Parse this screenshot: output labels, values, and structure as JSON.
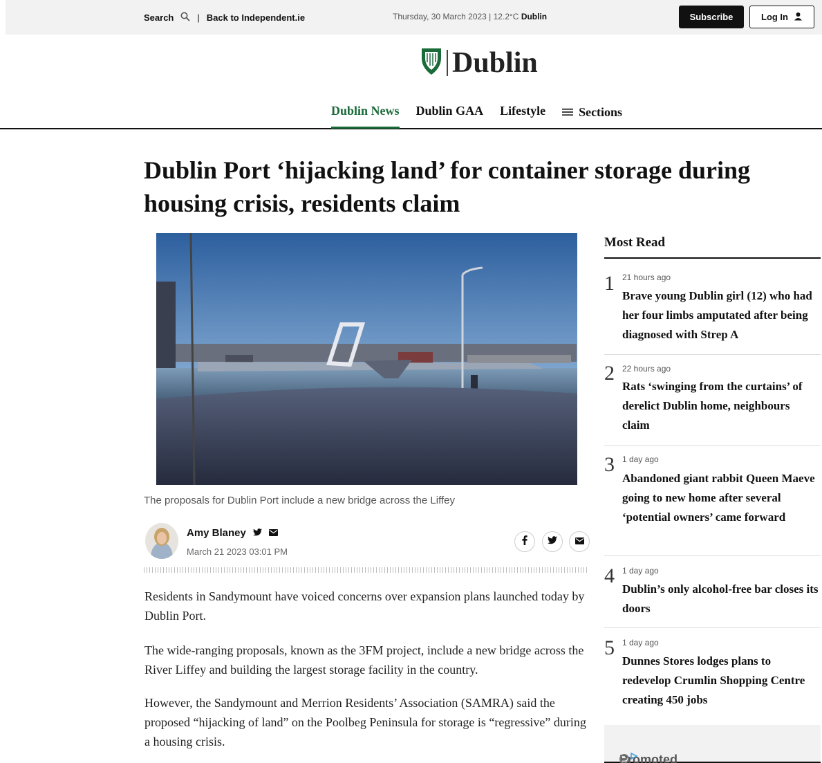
{
  "topbar": {
    "search_label": "Search",
    "back_label": "Back to Independent.ie",
    "date_weather": "Thursday, 30 March 2023 | 12.2°C",
    "city": "Dublin",
    "subscribe_label": "Subscribe",
    "login_label": "Log In"
  },
  "brand": {
    "name": "Dublin",
    "accent": "#1a6a3a"
  },
  "nav": {
    "items": [
      "Dublin News",
      "Dublin GAA",
      "Lifestyle"
    ],
    "sections_label": "Sections"
  },
  "article": {
    "headline": "Dublin Port ‘hijacking land’ for container storage during housing crisis, residents claim",
    "image_caption": "The proposals for Dublin Port include a new bridge across the Liffey",
    "author": "Amy Blaney",
    "date": "March 21 2023 03:01 PM",
    "paragraphs": [
      "Residents in Sandymount have voiced concerns over expansion plans launched today by Dublin Port.",
      "The wide-ranging proposals, known as the 3FM project, include a new bridge across the River Liffey and building the largest storage facility in the country.",
      "However, the Sandymount and Merrion Residents’ Association (SAMRA) said the proposed “hijacking of land” on the Poolbeg Peninsula for storage is “regressive” during a housing crisis."
    ]
  },
  "most_read": {
    "title": "Most Read",
    "items": [
      {
        "rank": "1",
        "time": "21 hours ago",
        "headline": "Brave young Dublin girl (12) who had her four limbs amputated after being diagnosed with Strep A"
      },
      {
        "rank": "2",
        "time": "22 hours ago",
        "headline": "Rats ‘swinging from the curtains’ of derelict Dublin home, neighbours claim"
      },
      {
        "rank": "3",
        "time": "1 day ago",
        "headline": "Abandoned giant rabbit Queen Maeve going to new home after several ‘potential owners’ came forward"
      },
      {
        "rank": "4",
        "time": "1 day ago",
        "headline": "Dublin’s only alcohol-free bar closes its doors"
      },
      {
        "rank": "5",
        "time": "1 day ago",
        "headline": "Dunnes Stores lodges plans to redevelop Crumlin Shopping Centre creating 450 jobs"
      }
    ]
  },
  "promoted": {
    "label": "Promoted Links by"
  }
}
